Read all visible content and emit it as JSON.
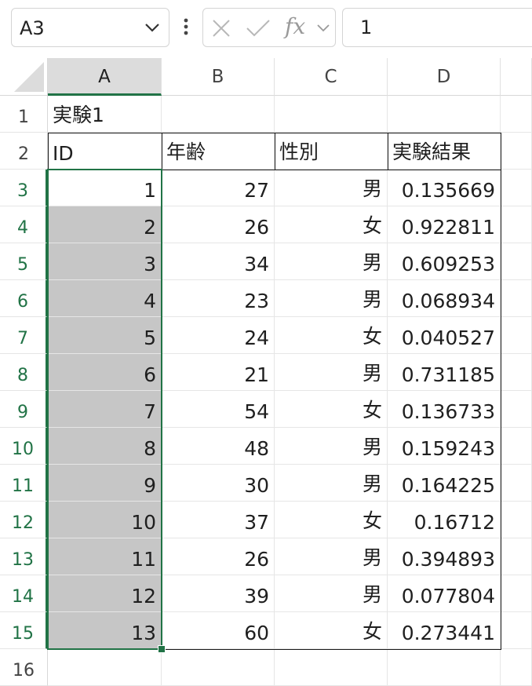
{
  "formula_bar": {
    "name_box": "A3",
    "fx_label": "fx",
    "formula_value": "1"
  },
  "columns": [
    "A",
    "B",
    "C",
    "D"
  ],
  "rows": [
    "1",
    "2",
    "3",
    "4",
    "5",
    "6",
    "7",
    "8",
    "9",
    "10",
    "11",
    "12",
    "13",
    "14",
    "15",
    "16"
  ],
  "sheet": {
    "title": "実験1",
    "headers": [
      "ID",
      "年齢",
      "性別",
      "実験結果"
    ],
    "records": [
      {
        "id": "1",
        "age": "27",
        "sex": "男",
        "result": "0.135669"
      },
      {
        "id": "2",
        "age": "26",
        "sex": "女",
        "result": "0.922811"
      },
      {
        "id": "3",
        "age": "34",
        "sex": "男",
        "result": "0.609253"
      },
      {
        "id": "4",
        "age": "23",
        "sex": "男",
        "result": "0.068934"
      },
      {
        "id": "5",
        "age": "24",
        "sex": "女",
        "result": "0.040527"
      },
      {
        "id": "6",
        "age": "21",
        "sex": "男",
        "result": "0.731185"
      },
      {
        "id": "7",
        "age": "54",
        "sex": "女",
        "result": "0.136733"
      },
      {
        "id": "8",
        "age": "48",
        "sex": "男",
        "result": "0.159243"
      },
      {
        "id": "9",
        "age": "30",
        "sex": "男",
        "result": "0.164225"
      },
      {
        "id": "10",
        "age": "37",
        "sex": "女",
        "result": "0.16712"
      },
      {
        "id": "11",
        "age": "26",
        "sex": "男",
        "result": "0.394893"
      },
      {
        "id": "12",
        "age": "39",
        "sex": "男",
        "result": "0.077804"
      },
      {
        "id": "13",
        "age": "60",
        "sex": "女",
        "result": "0.273441"
      }
    ]
  },
  "colors": {
    "selection_accent": "#217346",
    "selection_fill": "#c6c6c6"
  }
}
